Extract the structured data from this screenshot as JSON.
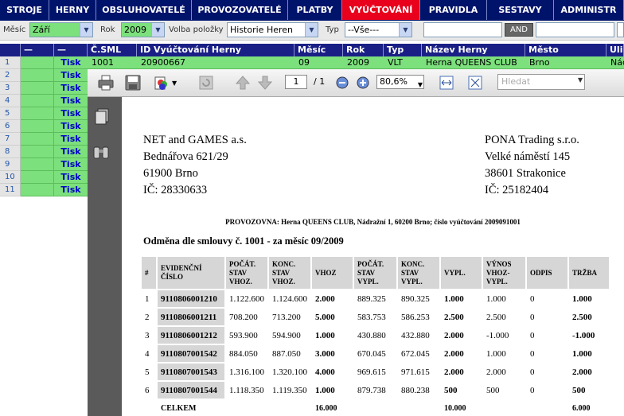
{
  "menu": [
    {
      "label": "STROJE",
      "active": false,
      "w": 62
    },
    {
      "label": "HERNY",
      "active": false,
      "w": 59
    },
    {
      "label": "OBSLUHOVATELÉ",
      "active": false,
      "w": 120
    },
    {
      "label": "PROVOZOVATELÉ",
      "active": false,
      "w": 121
    },
    {
      "label": "PLATBY",
      "active": false,
      "w": 68
    },
    {
      "label": "VYÚČTOVÁNÍ",
      "active": true,
      "w": 98
    },
    {
      "label": "PRAVIDLA",
      "active": false,
      "w": 84
    },
    {
      "label": "SESTAVY",
      "active": false,
      "w": 84
    },
    {
      "label": "ADMINISTR",
      "active": false,
      "w": 88
    }
  ],
  "filters": {
    "mesic_label": "Měsíc",
    "mesic_value": "Září",
    "rok_label": "Rok",
    "rok_value": "2009",
    "volba_label": "Volba položky",
    "volba_value": "Historie Heren",
    "typ_label": "Typ",
    "typ_value": "--Vše---",
    "and_label": "AND"
  },
  "grid": {
    "headers": [
      "—",
      "—",
      "Č.SML",
      "ID Vyúčtování Herny",
      "Měsíc",
      "Rok",
      "Typ",
      "Název Herny",
      "Město",
      "Ulice"
    ],
    "rows": [
      "1",
      "2",
      "3",
      "4",
      "5",
      "6",
      "7",
      "8",
      "9",
      "10",
      "11"
    ],
    "tisk_label": "Tisk",
    "row1": {
      "csml": "1001",
      "id": "20900667",
      "mesic": "09",
      "rok": "2009",
      "typ": "VLT",
      "nazev": "Herna QUEENS CLUB",
      "mesto": "Brno",
      "ulice": "Nádražní"
    }
  },
  "pdf_toolbar": {
    "page": "1",
    "page_total": "/ 1",
    "zoom": "80,6%",
    "search_placeholder": "Hledat"
  },
  "document": {
    "left_addr": [
      "NET and GAMES a.s.",
      "Bednářova 621/29",
      "61900 Brno",
      "IČ: 28330633"
    ],
    "right_addr": [
      "PONA Trading s.r.o.",
      "Velké náměstí 145",
      "38601 Strakonice",
      "IČ: 25182404"
    ],
    "provozovna": "PROVOZOVNA: Herna QUEENS CLUB, Nádražní 1, 60200 Brno; číslo vyúčtování 2009091001",
    "odmena": "Odměna dle smlouvy č. 1001 - za měsíc 09/2009",
    "table_headers": [
      "#",
      "EVIDENČNÍ ČÍSLO",
      "POČÁT. STAV VHOZ.",
      "KONC. STAV VHOZ.",
      "VHOZ",
      "POČÁT. STAV VYPL.",
      "KONC. STAV VYPL.",
      "VYPL.",
      "VÝNOS VHOZ- VYPL.",
      "ODPIS",
      "TRŽBA"
    ],
    "table_rows": [
      [
        "1",
        "9110806001210",
        "1.122.600",
        "1.124.600",
        "2.000",
        "889.325",
        "890.325",
        "1.000",
        "1.000",
        "0",
        "1.000"
      ],
      [
        "2",
        "9110806001211",
        "708.200",
        "713.200",
        "5.000",
        "583.753",
        "586.253",
        "2.500",
        "2.500",
        "0",
        "2.500"
      ],
      [
        "3",
        "9110806001212",
        "593.900",
        "594.900",
        "1.000",
        "430.880",
        "432.880",
        "2.000",
        "-1.000",
        "0",
        "-1.000"
      ],
      [
        "4",
        "9110807001542",
        "884.050",
        "887.050",
        "3.000",
        "670.045",
        "672.045",
        "2.000",
        "1.000",
        "0",
        "1.000"
      ],
      [
        "5",
        "9110807001543",
        "1.316.100",
        "1.320.100",
        "4.000",
        "969.615",
        "971.615",
        "2.000",
        "2.000",
        "0",
        "2.000"
      ],
      [
        "6",
        "9110807001544",
        "1.118.350",
        "1.119.350",
        "1.000",
        "879.738",
        "880.238",
        "500",
        "500",
        "0",
        "500"
      ]
    ],
    "total_row": [
      "",
      "CELKEM",
      "",
      "",
      "16.000",
      "",
      "",
      "10.000",
      "",
      "",
      "6.000"
    ]
  }
}
